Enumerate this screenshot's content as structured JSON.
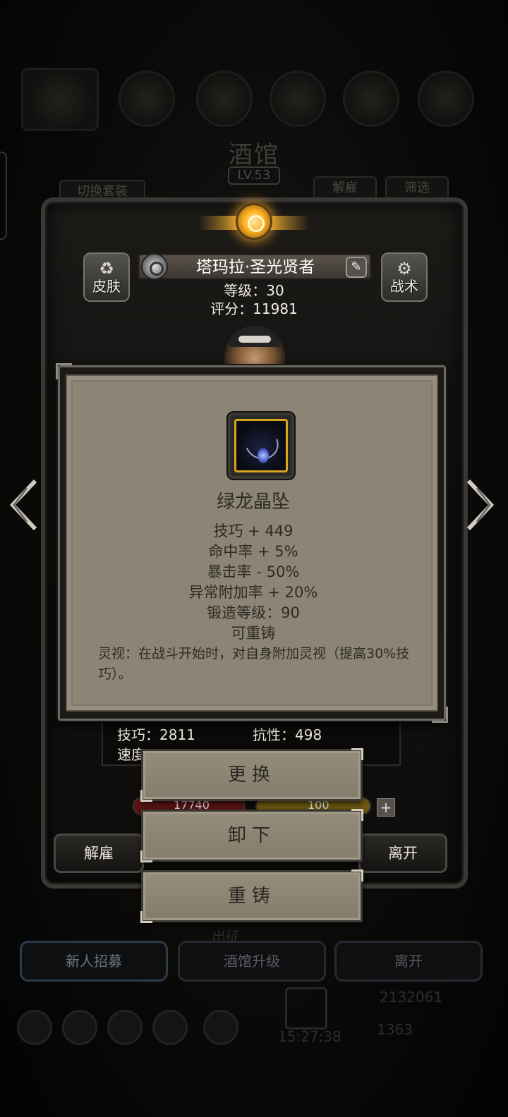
{
  "background": {
    "title": "酒馆",
    "level": "LV.53",
    "switch_outfit": "切换套装",
    "dismiss": "解雇",
    "filter": "筛选",
    "bottom_tabs": [
      "新人招募",
      "酒馆升级",
      "离开"
    ],
    "expedition": "出征",
    "gold": "2132061",
    "gems": "1363",
    "time": "15:27:38"
  },
  "hero": {
    "name": "塔玛拉·圣光贤者",
    "level_text": "等级：30",
    "score_text": "评分：11981",
    "skin_label": "皮肤",
    "tactics_label": "战术",
    "stats": {
      "skill": "技巧：2811",
      "resist": "抗性：498",
      "speed": "速度",
      "hp": "17740",
      "energy": "100"
    },
    "dismiss_button": "解雇",
    "leave_button": "离开"
  },
  "item": {
    "name": "绿龙晶坠",
    "attributes": [
      "技巧 + 449",
      "命中率 + 5%",
      "暴击率 - 50%",
      "异常附加率 + 20%",
      "锻造等级：90",
      "可重铸"
    ],
    "description": "灵视：在战斗开始时，对自身附加灵视（提高30%技巧）。"
  },
  "menu": {
    "replace": "更换",
    "unequip": "卸下",
    "reforge": "重铸"
  },
  "colors": {
    "accent_gold": "#ffb833",
    "tooltip_bg": "#8c8474",
    "button_bg": "#958d7b",
    "text_dark": "#2e2b27"
  }
}
